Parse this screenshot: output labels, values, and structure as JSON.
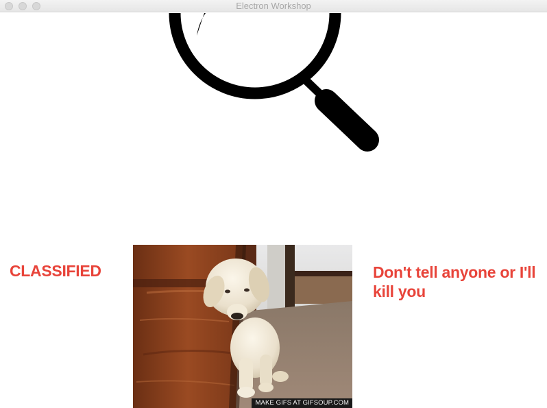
{
  "window": {
    "title": "Electron Workshop"
  },
  "icons": {
    "hero": "magnifying-glass-icon"
  },
  "content": {
    "left_label": "CLASSIFIED",
    "right_label": "Don't tell anyone or I'll kill you",
    "gif_caption": "MAKE GIFS AT GIFSOUP.COM"
  },
  "colors": {
    "accent_red": "#e8443a",
    "icon_black": "#000000"
  }
}
